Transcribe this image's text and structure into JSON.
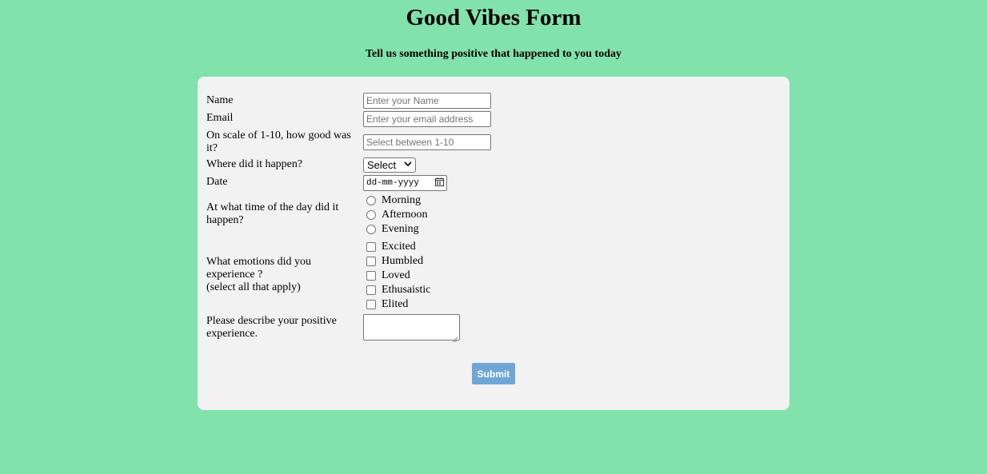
{
  "page": {
    "title": "Good Vibes Form",
    "subtitle": "Tell us something positive that happened to you today"
  },
  "form": {
    "name": {
      "label": "Name",
      "placeholder": "Enter your Name"
    },
    "email": {
      "label": "Email",
      "placeholder": "Enter your email address"
    },
    "scale": {
      "label": "On scale of 1-10, how good was it?",
      "placeholder": "Select between 1-10"
    },
    "place": {
      "label": "Where did it happen?",
      "selected": "Select"
    },
    "date": {
      "label": "Date",
      "value": "dd-mm-yyyy"
    },
    "time_of_day": {
      "label": "At what time of the day did it happen?",
      "options": [
        "Morning",
        "Afternoon",
        "Evening"
      ]
    },
    "emotions": {
      "label": "What emotions did you experience ?",
      "hint": "(select all that apply)",
      "options": [
        "Excited",
        "Humbled",
        "Loved",
        "Ethusaistic",
        "Elited"
      ]
    },
    "description": {
      "label": "Please describe your positive experience."
    },
    "submit_label": "Submit"
  },
  "icons": {
    "select_arrow": "chevron-down-icon",
    "date_picker": "calendar-icon"
  },
  "colors": {
    "background": "#82e2ac",
    "card": "#f2f2f2",
    "submit_button": "#6fa6d6"
  }
}
